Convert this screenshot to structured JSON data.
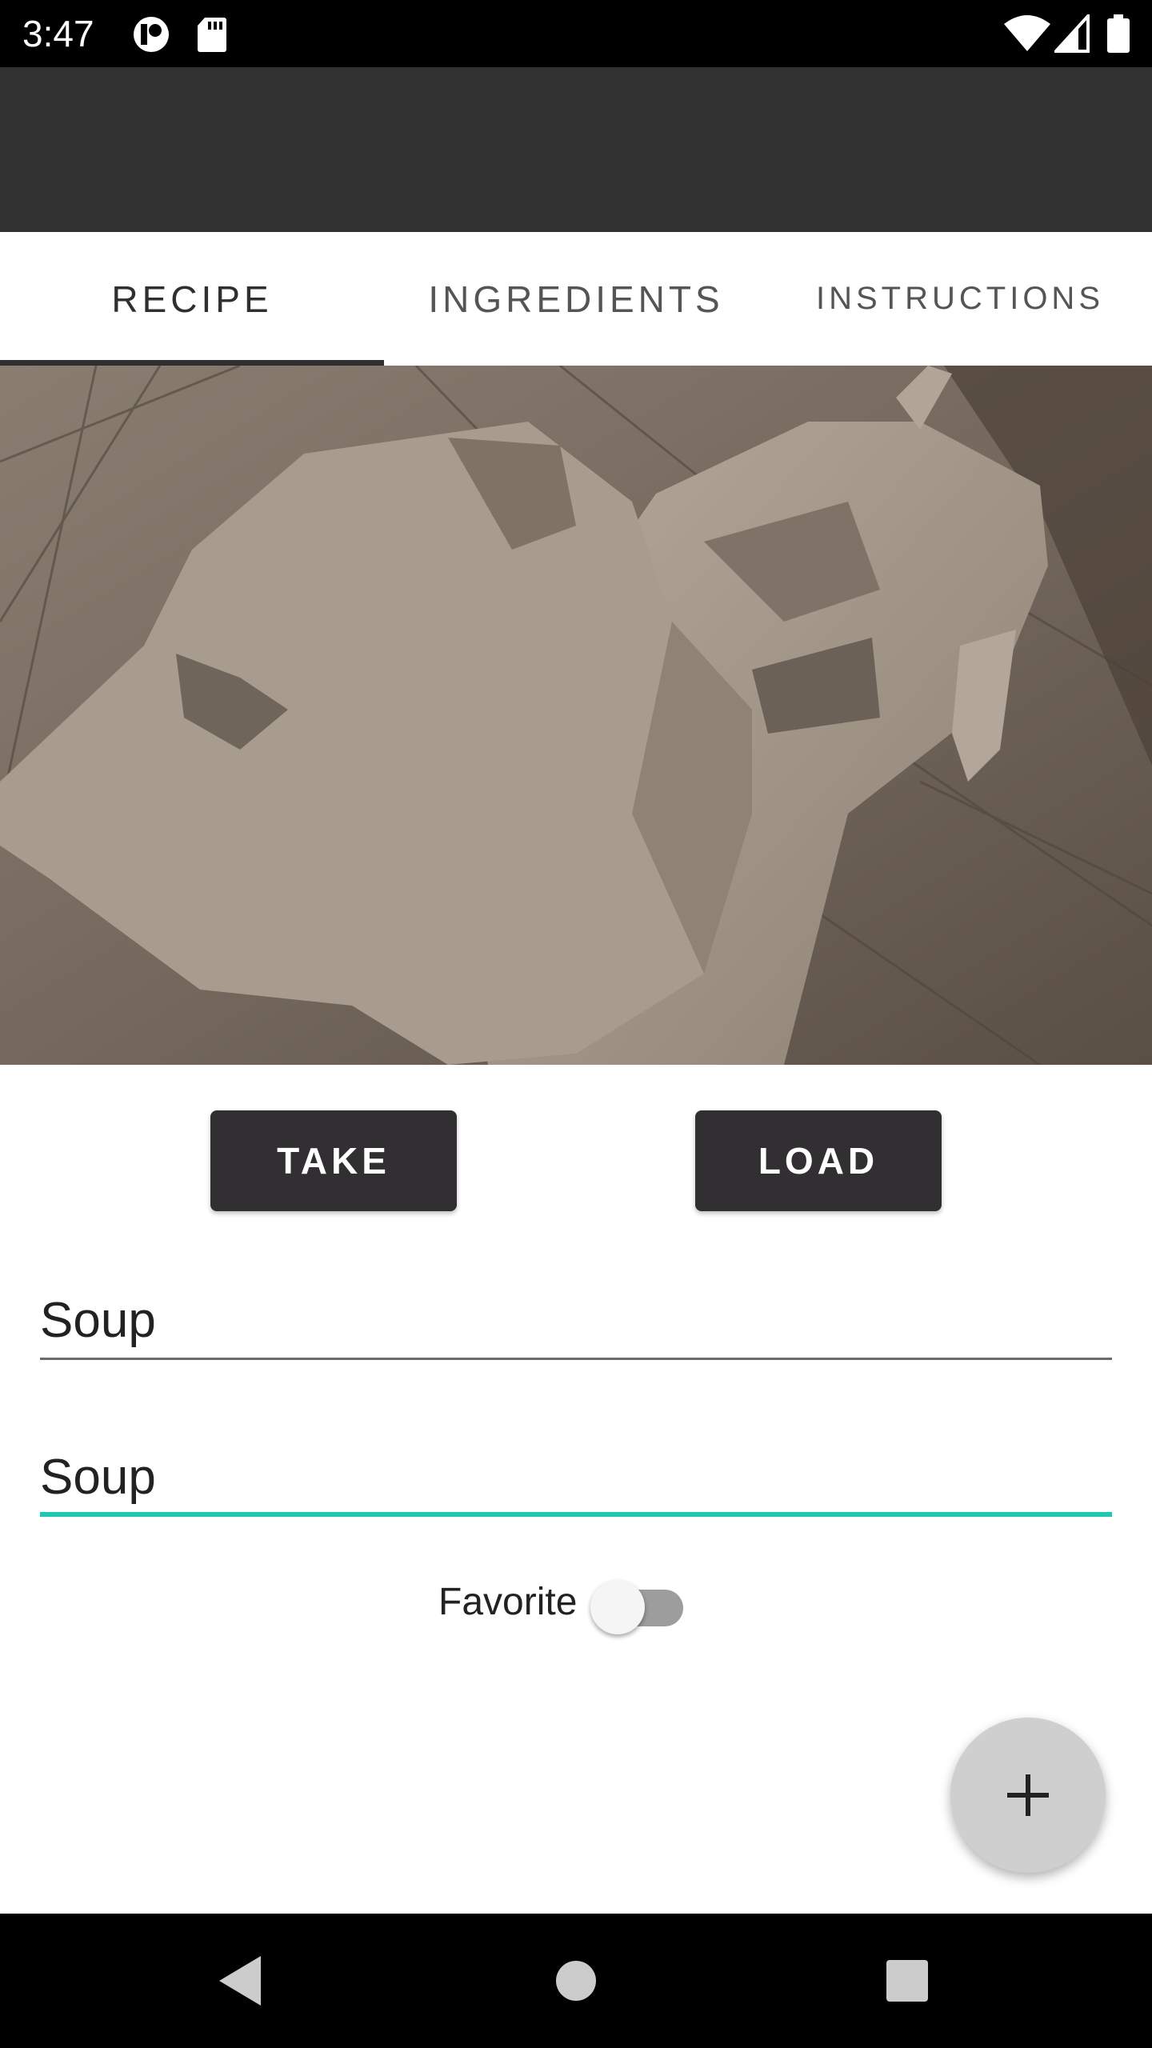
{
  "status_bar": {
    "time": "3:47",
    "left_icons": [
      "app-notification-icon",
      "sd-card-icon"
    ],
    "right_icons": [
      "wifi-icon",
      "cell-signal-icon",
      "battery-icon"
    ]
  },
  "tabs": [
    {
      "label": "RECIPE",
      "active": true
    },
    {
      "label": "INGREDIENTS",
      "active": false
    },
    {
      "label": "INSTRUCTIONS",
      "active": false
    }
  ],
  "photo": {
    "icon": "dog-photo"
  },
  "buttons": {
    "take_label": "TAKE",
    "load_label": "LOAD"
  },
  "fields": {
    "name_value": "Soup",
    "description_value": "Soup"
  },
  "favorite": {
    "label": "Favorite",
    "checked": false
  },
  "fab": {
    "icon": "plus-icon"
  },
  "nav_bar": {
    "icons": [
      "back-icon",
      "home-icon",
      "recents-icon"
    ]
  },
  "colors": {
    "app_bar": "#323132",
    "button": "#312f31",
    "accent": "#1ec7b4",
    "fab": "#cfcfcf"
  }
}
